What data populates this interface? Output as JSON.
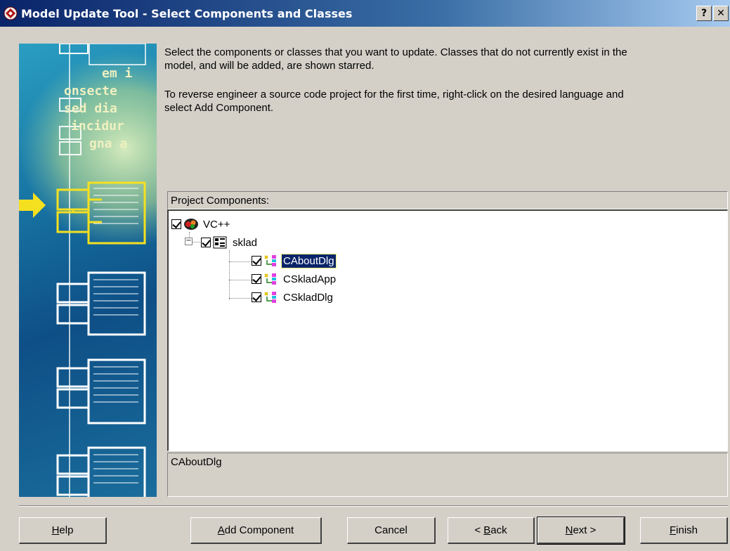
{
  "window": {
    "title": "Model Update Tool - Select Components and Classes",
    "help_glyph": "?",
    "close_glyph": "✕"
  },
  "instructions": {
    "line1": "Select the components or classes that you want to update. Classes that do not currently exist in the",
    "line2": "model, and will be added, are shown starred.",
    "line3": "To reverse engineer a source code project for the first time, right-click on the desired language and",
    "line4": "select Add Component."
  },
  "side_image": {
    "code_lines": [
      "em  i",
      "onsecte",
      "sed  dia",
      "incidur",
      "gna  a"
    ]
  },
  "project_components": {
    "header": "Project Components:",
    "root": {
      "label": "VC++",
      "checked": true
    },
    "project": {
      "label": "sklad",
      "checked": true,
      "expander": "−"
    },
    "classes": [
      {
        "label": "CAboutDlg",
        "checked": true,
        "selected": true
      },
      {
        "label": "CSkladApp",
        "checked": true,
        "selected": false
      },
      {
        "label": "CSkladDlg",
        "checked": true,
        "selected": false
      }
    ]
  },
  "status": {
    "text": "CAboutDlg"
  },
  "buttons": {
    "help": {
      "pre": "",
      "key": "H",
      "post": "elp"
    },
    "add_component": {
      "pre": "",
      "key": "A",
      "post": "dd Component"
    },
    "cancel": {
      "label": "Cancel"
    },
    "back": {
      "pre": "< ",
      "key": "B",
      "post": "ack"
    },
    "next": {
      "pre": "",
      "key": "N",
      "post": "ext >"
    },
    "finish": {
      "pre": "",
      "key": "F",
      "post": "inish"
    }
  },
  "colors": {
    "titlebar_start": "#0a246a",
    "titlebar_end": "#a6caf0",
    "dialog_face": "#d4d0c8",
    "selection": "#0a246a",
    "arrow": "#f5e020"
  }
}
